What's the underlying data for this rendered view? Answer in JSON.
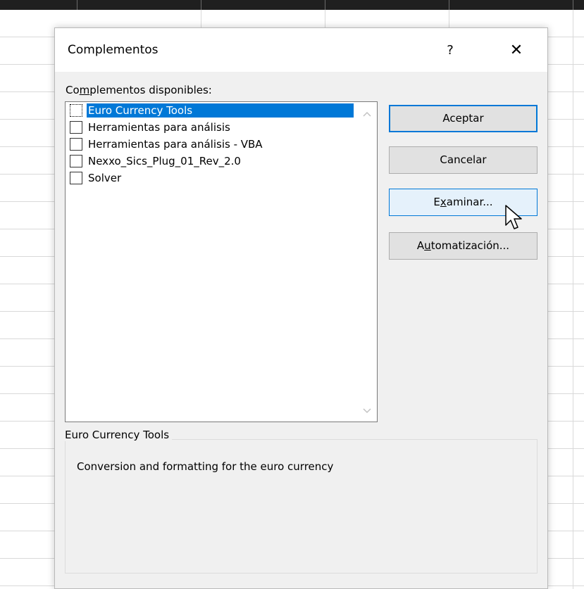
{
  "dialog": {
    "title": "Complementos",
    "help_label": "?",
    "close_label": "✕"
  },
  "addins": {
    "label_prefix": "Co",
    "label_access_key": "m",
    "label_rest": "plementos disponibles:",
    "items": [
      {
        "label": "Euro Currency Tools",
        "checked": false,
        "selected": true
      },
      {
        "label": "Herramientas para análisis",
        "checked": false,
        "selected": false
      },
      {
        "label": "Herramientas para análisis - VBA",
        "checked": false,
        "selected": false
      },
      {
        "label": "Nexxo_Sics_Plug_01_Rev_2.0",
        "checked": false,
        "selected": false
      },
      {
        "label": "Solver",
        "checked": false,
        "selected": false
      }
    ]
  },
  "buttons": {
    "accept": "Aceptar",
    "cancel": "Cancelar",
    "browse_prefix": "E",
    "browse_access_key": "x",
    "browse_rest": "aminar...",
    "automation_prefix": "A",
    "automation_access_key": "u",
    "automation_rest": "tomatización..."
  },
  "description": {
    "title": "Euro Currency Tools",
    "text": "Conversion and formatting for the euro currency"
  },
  "colors": {
    "selection": "#0078d7",
    "dialog_bg": "#f0f0f0"
  }
}
